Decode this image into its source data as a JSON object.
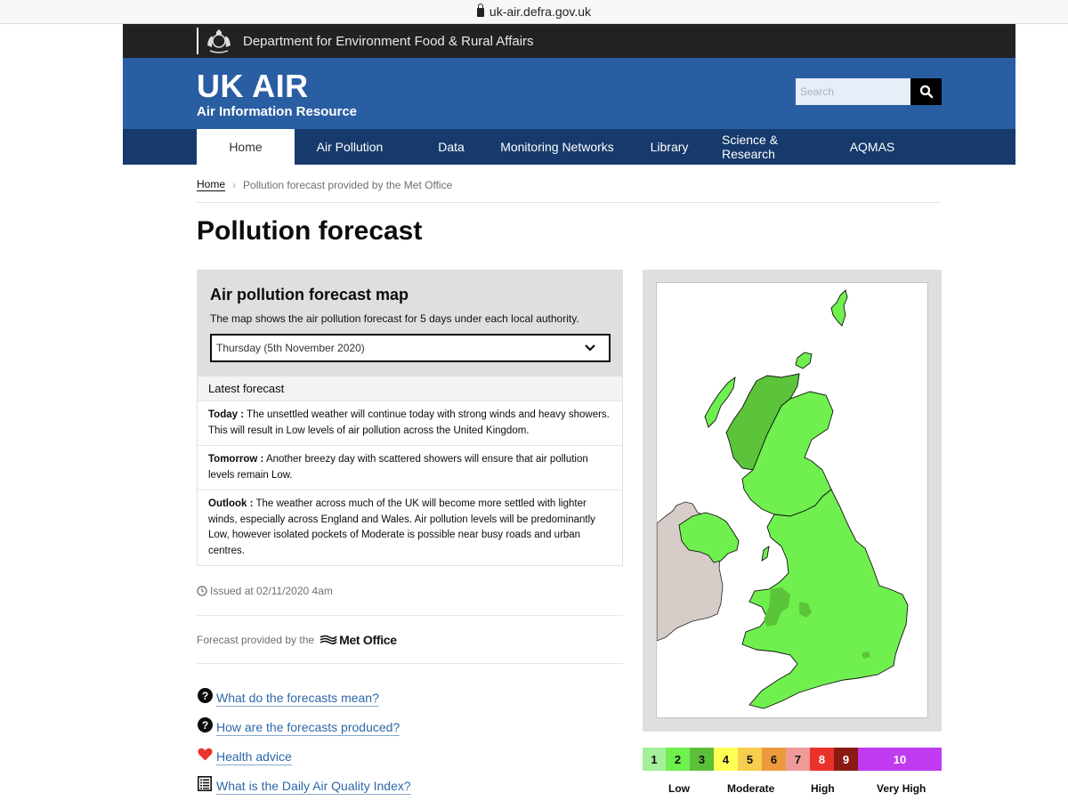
{
  "browser": {
    "url": "uk-air.defra.gov.uk"
  },
  "header": {
    "department": "Department for Environment Food & Rural Affairs",
    "site_title": "UK AIR",
    "site_subtitle": "Air Information Resource",
    "search_placeholder": "Search"
  },
  "nav": {
    "items": [
      {
        "label": "Home",
        "active": true
      },
      {
        "label": "Air Pollution"
      },
      {
        "label": "Data"
      },
      {
        "label": "Monitoring Networks"
      },
      {
        "label": "Library"
      },
      {
        "label": "Science & Research"
      },
      {
        "label": "AQMAS"
      }
    ]
  },
  "breadcrumb": {
    "home": "Home",
    "current": "Pollution forecast provided by the Met Office"
  },
  "page_title": "Pollution forecast",
  "forecast_map": {
    "heading": "Air pollution forecast map",
    "description": "The map shows the air pollution forecast for 5 days under each local authority.",
    "selected_day": "Thursday (5th November 2020)"
  },
  "latest_forecast": {
    "heading": "Latest forecast",
    "entries": [
      {
        "label": "Today :",
        "text": "The unsettled weather will continue today with strong winds and heavy showers. This will result in Low levels of air pollution across the United Kingdom."
      },
      {
        "label": "Tomorrow :",
        "text": "Another breezy day with scattered showers will ensure that air pollution levels remain Low."
      },
      {
        "label": "Outlook :",
        "text": "The weather across much of the UK will become more settled with lighter winds, especially across England and Wales. Air pollution levels will be predominantly Low, however isolated pockets of Moderate is possible near busy roads and urban centres."
      }
    ]
  },
  "issued": "Issued at 02/11/2020 4am",
  "provided_by": {
    "prefix": "Forecast provided by the",
    "brand": "Met Office"
  },
  "help_links": [
    {
      "icon": "question-circle-icon",
      "label": "What do the forecasts mean?"
    },
    {
      "icon": "question-circle-icon",
      "label": "How are the forecasts produced?"
    },
    {
      "icon": "heart-icon",
      "label": "Health advice"
    },
    {
      "icon": "list-document-icon",
      "label": "What is the Daily Air Quality Index?"
    }
  ],
  "map": {
    "region_colors": {
      "index_1_low": "#9cf08b",
      "index_2_low": "#6ff04e",
      "index_3_low": "#5cc43a",
      "ireland_no_data": "#d6cdc8"
    }
  },
  "daqi_legend": {
    "bands": [
      {
        "value": "1",
        "color": "#a3ef9a",
        "text_color": "#111111"
      },
      {
        "value": "2",
        "color": "#6ff04e",
        "text_color": "#111111"
      },
      {
        "value": "3",
        "color": "#5cbf3a",
        "text_color": "#111111"
      },
      {
        "value": "4",
        "color": "#ffff55",
        "text_color": "#111111"
      },
      {
        "value": "5",
        "color": "#f6cd4e",
        "text_color": "#111111"
      },
      {
        "value": "6",
        "color": "#ed9a3e",
        "text_color": "#111111"
      },
      {
        "value": "7",
        "color": "#ee9a98",
        "text_color": "#111111"
      },
      {
        "value": "8",
        "color": "#e9332a",
        "text_color": "#ffffff"
      },
      {
        "value": "9",
        "color": "#8c1a14",
        "text_color": "#ffffff"
      },
      {
        "value": "10",
        "color": "#c03af0",
        "text_color": "#ffffff"
      }
    ],
    "labels": [
      "Low",
      "Moderate",
      "High",
      "Very High"
    ]
  }
}
